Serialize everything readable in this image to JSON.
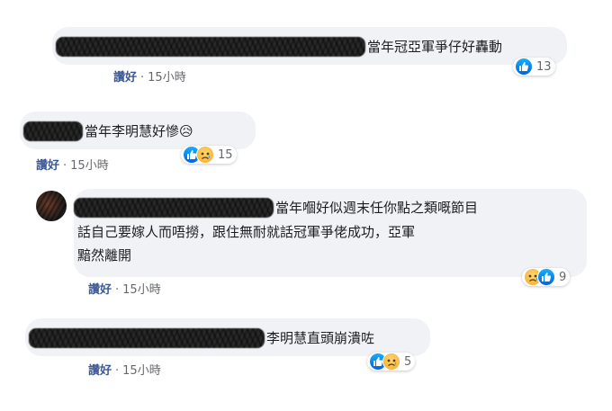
{
  "comments": [
    {
      "text": "當年冠亞軍爭仔好轟動",
      "like_label": "讚好",
      "separator": "·",
      "time": "15小時",
      "reaction_count": "13",
      "reactions": [
        "like"
      ]
    },
    {
      "text": "當年李明慧好慘😥",
      "like_label": "讚好",
      "separator": "·",
      "time": "15小時",
      "reaction_count": "15",
      "reactions": [
        "like",
        "sad"
      ]
    },
    {
      "text_line1": "當年嗰好似週末任你點之類嘅節目",
      "text_line2": "話自己要嫁人而唔撈，跟住無耐就話冠軍爭佬成功，亞軍",
      "text_line3": "黯然離開",
      "like_label": "讚好",
      "separator": "·",
      "time": "15小時",
      "reaction_count": "9",
      "reactions": [
        "sad",
        "like"
      ]
    },
    {
      "text": "李明慧直頭崩潰咗",
      "like_label": "讚好",
      "separator": "·",
      "time": "15小時",
      "reaction_count": "5",
      "reactions": [
        "like",
        "sad"
      ]
    }
  ],
  "icons": {
    "like": "like-reaction-icon",
    "sad": "sad-reaction-icon"
  },
  "colors": {
    "like_blue": "#1877f2",
    "sad_yellow": "#f7b125",
    "bubble_bg": "#f0f2f5"
  }
}
